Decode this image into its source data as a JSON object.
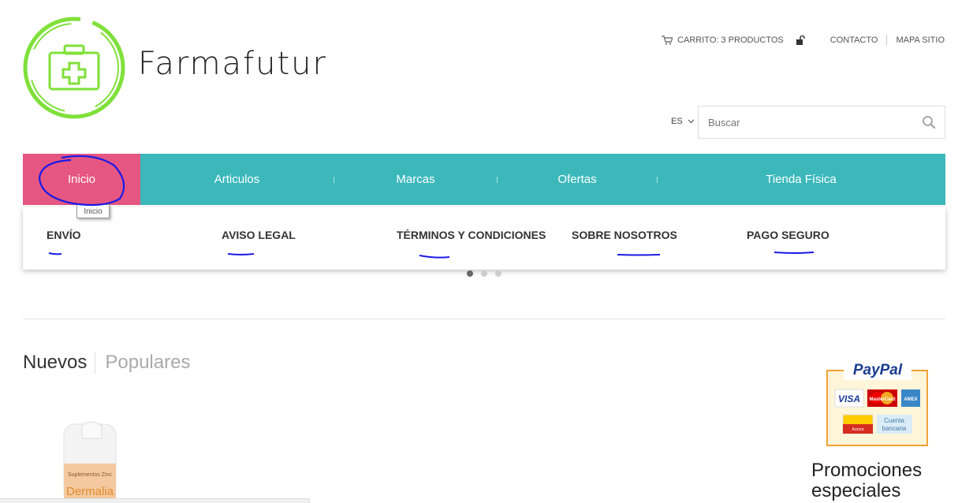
{
  "brand": {
    "name": "Farmafutur",
    "accent": "#7fe03a"
  },
  "toplinks": {
    "cart": "CARRITO: 3 PRODUCTOS",
    "contact": "CONTACTO",
    "sitemap": "MAPA SITIO"
  },
  "lang": {
    "selected": "ES"
  },
  "search": {
    "placeholder": "Buscar"
  },
  "nav": {
    "color": "#3cb8bb",
    "active_color": "#e65683",
    "items": [
      {
        "label": "Inicio"
      },
      {
        "label": "Articulos"
      },
      {
        "label": "Marcas"
      },
      {
        "label": "Ofertas"
      },
      {
        "label": "Tienda Física"
      }
    ],
    "tooltip": "Inicio"
  },
  "infobar": {
    "items": [
      {
        "label": "ENVÍO"
      },
      {
        "label": "AVISO LEGAL"
      },
      {
        "label": "TÉRMINOS Y CONDICIONES"
      },
      {
        "label": "SOBRE NOSOTROS"
      },
      {
        "label": "PAGO SEGURO"
      }
    ]
  },
  "tabs": {
    "new": "Nuevos",
    "popular": "Populares"
  },
  "product": {
    "label_line1": "Suplementos Zinc",
    "label_line2": "Dermalia"
  },
  "paypal": {
    "title": "PayPal",
    "visa": "VISA",
    "mastercard": "MasterCard",
    "amex": "AMEX",
    "aurora": "Aurora",
    "bank_line1": "Cuenta",
    "bank_line2": "bancaria"
  },
  "promo": {
    "title_line1": "Promociones",
    "title_line2": "especiales"
  }
}
